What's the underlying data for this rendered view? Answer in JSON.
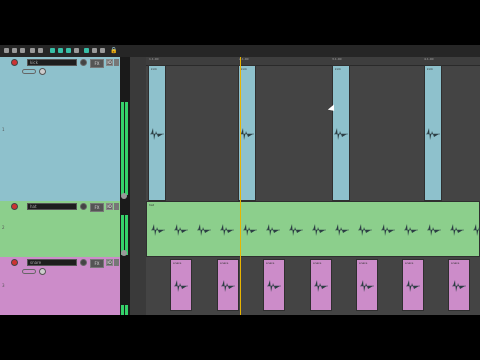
{
  "toolbar": {
    "icons": [
      {
        "name": "new-project-icon",
        "color": "#9a9a9a"
      },
      {
        "name": "open-icon",
        "color": "#9a9a9a"
      },
      {
        "name": "save-icon",
        "color": "#9a9a9a"
      },
      {
        "name": "undo-icon",
        "color": "#9a9a9a"
      },
      {
        "name": "redo-icon",
        "color": "#9a9a9a"
      },
      {
        "name": "snap-icon",
        "color": "#37c0a8"
      },
      {
        "name": "grid-icon",
        "color": "#37c0a8"
      },
      {
        "name": "ripple-icon",
        "color": "#37c0a8"
      },
      {
        "name": "loop-icon",
        "color": "#9a9a9a"
      },
      {
        "name": "envelope-icon",
        "color": "#37c0a8"
      },
      {
        "name": "metronome-icon",
        "color": "#9a9a9a"
      },
      {
        "name": "lock-icon",
        "color": "#9a9a9a"
      }
    ]
  },
  "tracks": [
    {
      "number": "1",
      "name": "kick",
      "color": "#8ec1cc",
      "fx": "FX",
      "io": "IO"
    },
    {
      "number": "2",
      "name": "hat",
      "color": "#8ccf8c",
      "fx": "FX",
      "io": "IO"
    },
    {
      "number": "3",
      "name": "snare",
      "color": "#cc8cc9",
      "fx": "FX",
      "io": "IO"
    }
  ],
  "ruler": {
    "marks": [
      "1.1.00",
      "2.1.00",
      "3.1.00",
      "4.1.00"
    ]
  },
  "items": {
    "kick": [
      "kick",
      "kick",
      "kick",
      "kick"
    ],
    "hat": "hat",
    "snare": [
      "snare",
      "snare",
      "snare",
      "snare",
      "snare",
      "snare",
      "snare"
    ]
  },
  "colors": {
    "accent": "#37c0a8",
    "meter": "#35d26a",
    "play_cursor": "#e8b400",
    "background": "#333333"
  }
}
